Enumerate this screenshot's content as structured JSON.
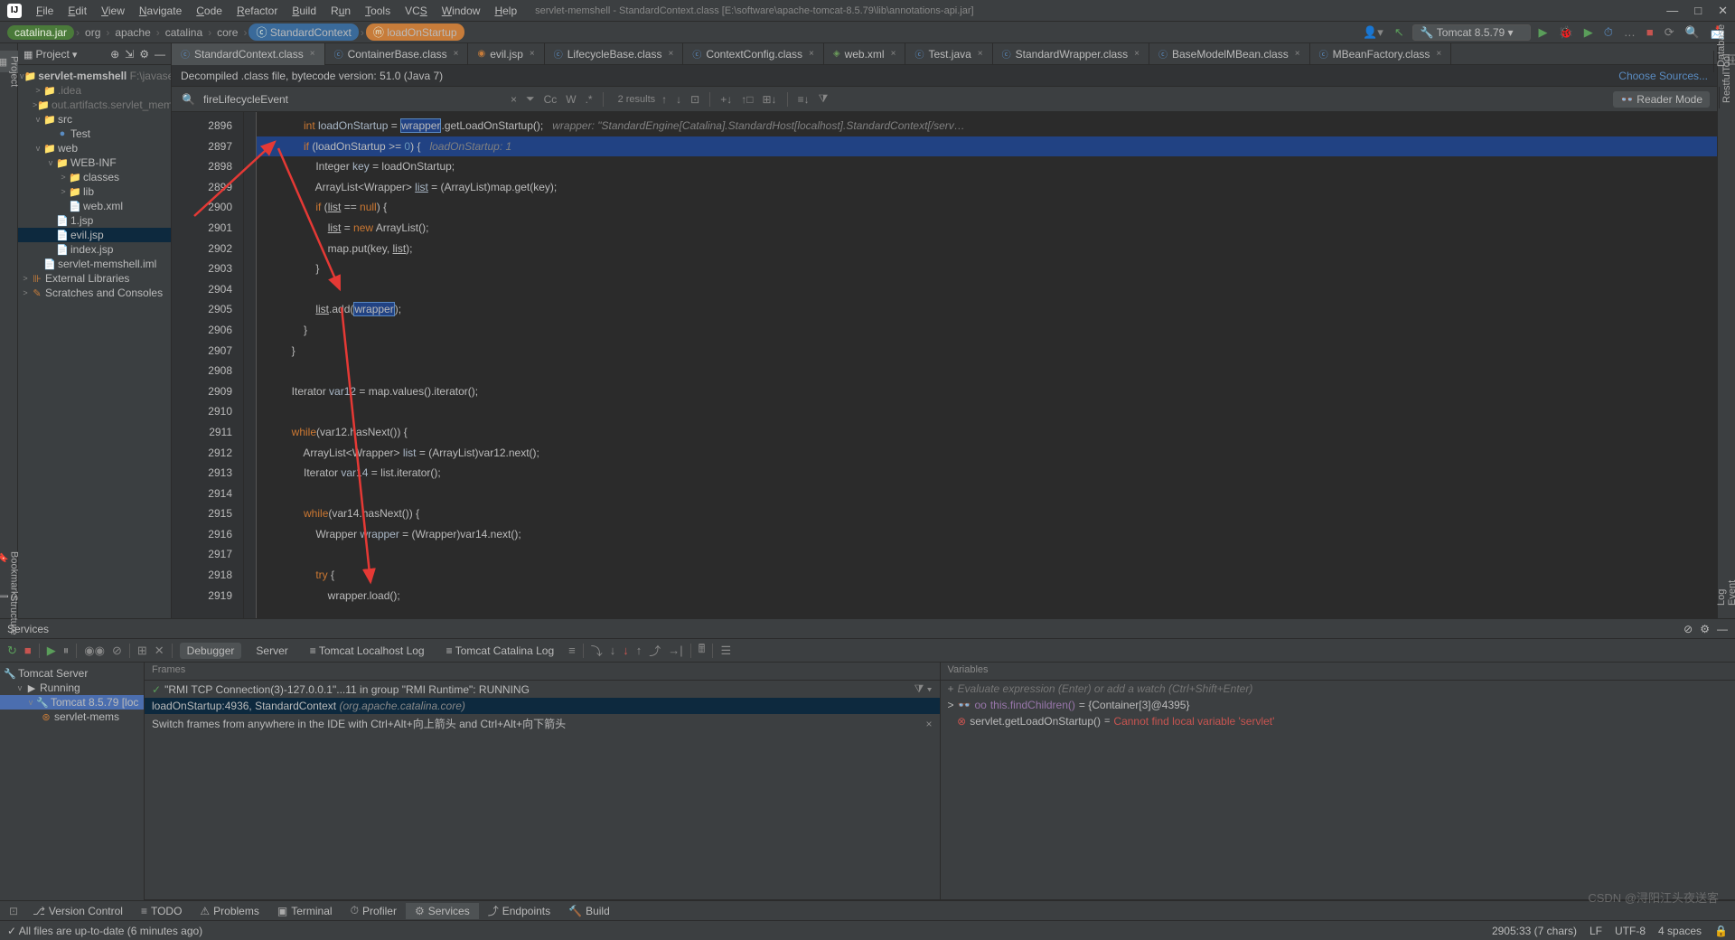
{
  "window_title": "servlet-memshell - StandardContext.class [E:\\software\\apache-tomcat-8.5.79\\lib\\annotations-api.jar]",
  "menu": [
    "File",
    "Edit",
    "View",
    "Navigate",
    "Code",
    "Refactor",
    "Build",
    "Run",
    "Tools",
    "VCS",
    "Window",
    "Help"
  ],
  "breadcrumbs": [
    "catalina.jar",
    "org",
    "apache",
    "catalina",
    "core",
    "StandardContext",
    "loadOnStartup"
  ],
  "run_config": "Tomcat 8.5.79",
  "project": {
    "title": "Project",
    "root": "servlet-memshell",
    "root_path": "F:\\javasec-en",
    "items": [
      {
        "depth": 1,
        "arrow": ">",
        "icon": "📁",
        "label": ".idea",
        "dim": true
      },
      {
        "depth": 1,
        "arrow": ">",
        "icon": "📁",
        "label": "out.artifacts.servlet_memshell",
        "dim": true
      },
      {
        "depth": 1,
        "arrow": "v",
        "icon": "📁",
        "label": "src",
        "color": "#5a8cc2"
      },
      {
        "depth": 2,
        "arrow": "",
        "icon": "●",
        "label": "Test",
        "iconcolor": "#5a8cc2"
      },
      {
        "depth": 1,
        "arrow": "v",
        "icon": "📁",
        "label": "web",
        "color": "#5a8cc2"
      },
      {
        "depth": 2,
        "arrow": "v",
        "icon": "📁",
        "label": "WEB-INF"
      },
      {
        "depth": 3,
        "arrow": ">",
        "icon": "📁",
        "label": "classes"
      },
      {
        "depth": 3,
        "arrow": ">",
        "icon": "📁",
        "label": "lib"
      },
      {
        "depth": 3,
        "arrow": "",
        "icon": "📄",
        "label": "web.xml"
      },
      {
        "depth": 2,
        "arrow": "",
        "icon": "📄",
        "label": "1.jsp",
        "iconcolor": "#c77c3a"
      },
      {
        "depth": 2,
        "arrow": "",
        "icon": "📄",
        "label": "evil.jsp",
        "iconcolor": "#c77c3a",
        "sel": true
      },
      {
        "depth": 2,
        "arrow": "",
        "icon": "📄",
        "label": "index.jsp",
        "iconcolor": "#c77c3a"
      },
      {
        "depth": 1,
        "arrow": "",
        "icon": "📄",
        "label": "servlet-memshell.iml"
      }
    ],
    "ext_lib": "External Libraries",
    "scratches": "Scratches and Consoles"
  },
  "editor_tabs": [
    {
      "icon": "c",
      "label": "StandardContext.class",
      "x": true,
      "active": true
    },
    {
      "icon": "c",
      "label": "ContainerBase.class",
      "x": true
    },
    {
      "icon": "o",
      "label": "evil.jsp",
      "x": true
    },
    {
      "icon": "c",
      "label": "LifecycleBase.class",
      "x": true
    },
    {
      "icon": "c",
      "label": "ContextConfig.class",
      "x": true
    },
    {
      "icon": "g",
      "label": "web.xml",
      "x": true
    },
    {
      "icon": "c",
      "label": "Test.java",
      "x": true
    },
    {
      "icon": "c",
      "label": "StandardWrapper.class",
      "x": true
    },
    {
      "icon": "c",
      "label": "BaseModelMBean.class",
      "x": true
    },
    {
      "icon": "c",
      "label": "MBeanFactory.class",
      "x": true
    }
  ],
  "decompile_msg": "Decompiled .class file, bytecode version: 51.0 (Java 7)",
  "choose_sources": "Choose Sources...",
  "find": {
    "query": "fireLifecycleEvent",
    "results": "2 results",
    "reader": "Reader Mode"
  },
  "code_lines": [
    2896,
    2897,
    2898,
    2899,
    2900,
    2901,
    2902,
    2903,
    2904,
    2905,
    2906,
    2907,
    2908,
    2909,
    2910,
    2911,
    2912,
    2913,
    2914,
    2915,
    2916,
    2917,
    2918,
    2919
  ],
  "hint1": "wrapper: \"StandardEngine[Catalina].StandardHost[localhost].StandardContext[/serv…",
  "hint2": "loadOnStartup: 1",
  "svc": {
    "title": "Services",
    "tabs": [
      "Debugger",
      "Server",
      "Tomcat Localhost Log",
      "Tomcat Catalina Log"
    ],
    "tree_root": "Tomcat Server",
    "running": "Running",
    "conf": "Tomcat 8.5.79 [loc",
    "app": "servlet-mems",
    "frames": "Frames",
    "vars": "Variables",
    "thread": "\"RMI TCP Connection(3)-127.0.0.1\"...11 in group \"RMI Runtime\": RUNNING",
    "frame1": "loadOnStartup:4936, StandardContext",
    "frame1_pkg": "(org.apache.catalina.core)",
    "switch_hint": "Switch frames from anywhere in the IDE with Ctrl+Alt+向上箭头 and Ctrl+Alt+向下箭头",
    "eval_ph": "Evaluate expression (Enter) or add a watch (Ctrl+Shift+Enter)",
    "var1_name": "this.findChildren()",
    "var1_val": "= {Container[3]@4395}",
    "var2_name": "servlet.getLoadOnStartup()",
    "var2_err": "Cannot find local variable 'servlet'"
  },
  "bottom_tabs": [
    "Version Control",
    "TODO",
    "Problems",
    "Terminal",
    "Profiler",
    "Services",
    "Endpoints",
    "Build"
  ],
  "status_msg": "All files are up-to-date (6 minutes ago)",
  "status_pos": "2905:33 (7 chars)",
  "status_enc": "UTF-8",
  "status_sp": "4 spaces",
  "watermark": "CSDN @浔阳江头夜送客"
}
